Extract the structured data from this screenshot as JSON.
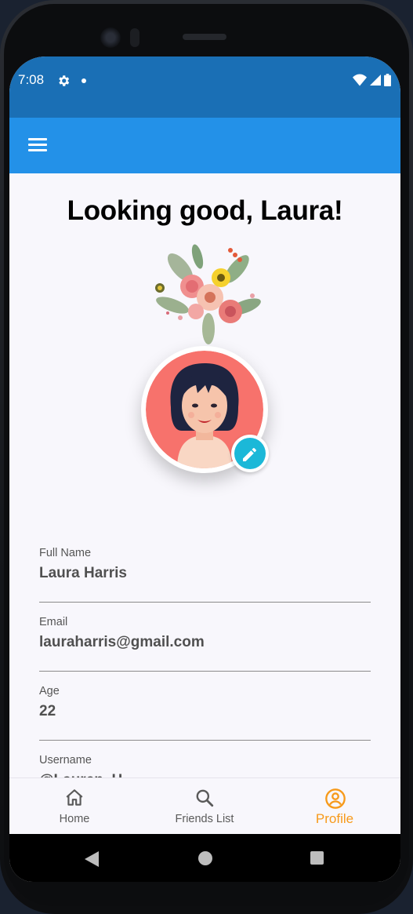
{
  "status_bar": {
    "time": "7:08",
    "icons": [
      "gear-icon",
      "notification-dot-icon",
      "wifi-icon",
      "signal-icon",
      "battery-icon"
    ]
  },
  "app_bar": {
    "menu_icon": "hamburger-menu-icon"
  },
  "profile": {
    "greeting": "Looking good, Laura!",
    "decoration": "flower-bouquet-illustration",
    "avatar": "woman-avatar-illustration",
    "edit_icon": "pencil-icon",
    "fields": [
      {
        "label": "Full Name",
        "value": "Laura Harris"
      },
      {
        "label": "Email",
        "value": "lauraharris@gmail.com"
      },
      {
        "label": "Age",
        "value": "22"
      },
      {
        "label": "Username",
        "value": "@Lauren_H"
      }
    ]
  },
  "bottom_nav": {
    "items": [
      {
        "label": "Home",
        "icon": "home-icon",
        "active": false
      },
      {
        "label": "Friends List",
        "icon": "search-icon",
        "active": false
      },
      {
        "label": "Profile",
        "icon": "profile-icon",
        "active": true
      }
    ]
  },
  "colors": {
    "status_bar": "#1a6fb5",
    "app_bar": "#2391e8",
    "active_nav": "#f79a1a",
    "edit_button": "#1bb8d8",
    "avatar_bg": "#f7726c"
  }
}
